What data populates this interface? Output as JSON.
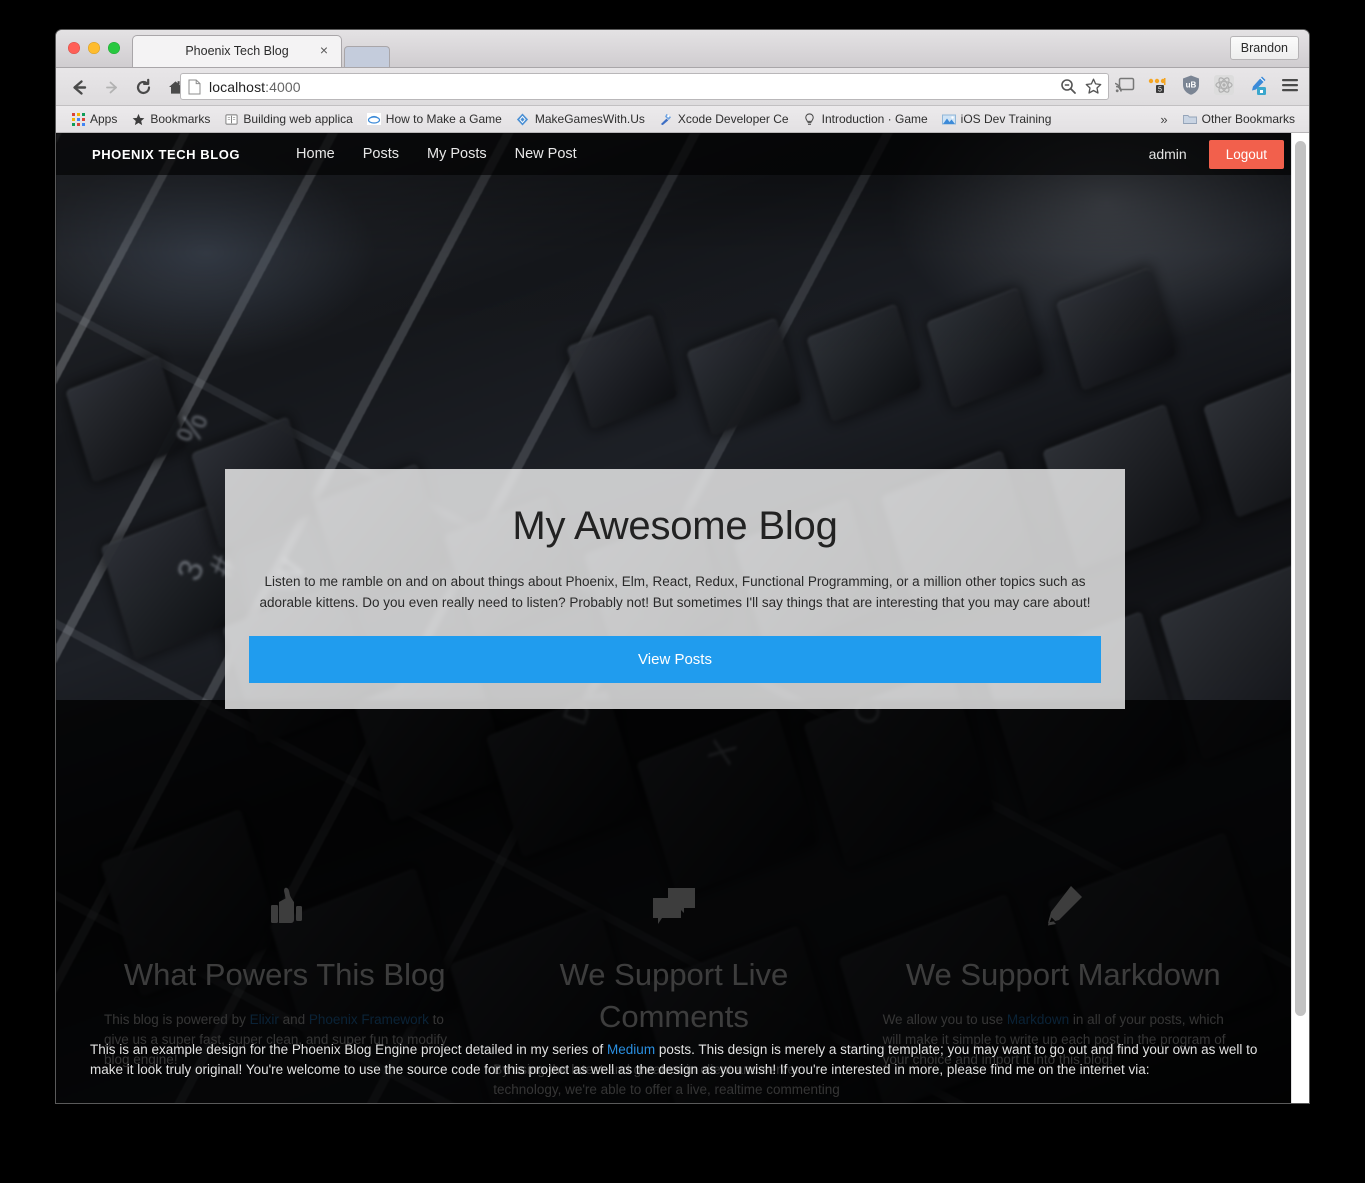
{
  "browser": {
    "profile_button": "Brandon",
    "tab_title": "Phoenix Tech Blog",
    "tab_close_glyph": "×",
    "url_display": "localhost:4000",
    "url_host": "localhost",
    "url_port": ":4000",
    "nav_icons": {
      "back": "back-arrow-icon",
      "forward": "forward-arrow-icon",
      "reload": "reload-icon",
      "home": "home-icon",
      "zoom_out": "zoom-out-icon",
      "bookmark_star": "star-icon",
      "cast": "cast-icon",
      "extension_dots": "colored-dots-extension-icon",
      "shield": "ublock-shield-icon",
      "atom": "react-devtools-icon",
      "eyedropper": "color-picker-icon",
      "menu": "hamburger-menu-icon"
    },
    "bookmarks": [
      {
        "label": "Apps",
        "icon": "apps-grid-icon"
      },
      {
        "label": "Bookmarks",
        "icon": "star-icon"
      },
      {
        "label": "Building web applica",
        "icon": "book-icon"
      },
      {
        "label": "How to Make a Game",
        "icon": "cloud-icon"
      },
      {
        "label": "MakeGamesWith.Us",
        "icon": "blue-diamond-icon"
      },
      {
        "label": "Xcode Developer Ce",
        "icon": "xcode-hammer-icon"
      },
      {
        "label": "Introduction · Game",
        "icon": "lightbulb-icon"
      },
      {
        "label": "iOS Dev Training",
        "icon": "mountain-photo-icon"
      }
    ],
    "overflow_glyph": "»",
    "other_bookmarks": {
      "label": "Other Bookmarks",
      "icon": "folder-icon"
    }
  },
  "site": {
    "navbar": {
      "brand": "PHOENIX TECH BLOG",
      "links": [
        {
          "label": "Home"
        },
        {
          "label": "Posts"
        },
        {
          "label": "My Posts"
        },
        {
          "label": "New Post"
        }
      ],
      "username": "admin",
      "logout_label": "Logout",
      "logout_color": "#f2604c"
    },
    "hero": {
      "title": "My Awesome Blog",
      "subtitle": "Listen to me ramble on and on about things about Phoenix, Elm, React, Redux, Functional Programming, or a million other topics such as adorable kittens. Do you even really need to listen? Probably not! But sometimes I'll say things that are interesting that you may care about!",
      "cta_label": "View Posts",
      "cta_color": "#209cee"
    },
    "features": [
      {
        "icon": "thumbs-up-icon",
        "heading": "What Powers This Blog",
        "body_parts": [
          {
            "text": "This blog is powered by ",
            "link": false
          },
          {
            "text": "Elixir",
            "link": true
          },
          {
            "text": " and ",
            "link": false
          },
          {
            "text": "Phoenix Framework",
            "link": true
          },
          {
            "text": " to give us a super fast, super clean, and super fun to modify blog engine!",
            "link": false
          }
        ]
      },
      {
        "icon": "speech-bubbles-icon",
        "heading": "We Support Live Comments",
        "body_parts": [
          {
            "text": "By using the latest and greatest in client and server technology, we're able to offer a live, realtime commenting system with nearly no impact to performance!",
            "link": false
          }
        ]
      },
      {
        "icon": "pencil-icon",
        "heading": "We Support Markdown",
        "body_parts": [
          {
            "text": "We allow you to use ",
            "link": false
          },
          {
            "text": "Markdown",
            "link": true
          },
          {
            "text": " in all of your posts, which will make it simple to write up each post in the program of your choice and import it into this blog!",
            "link": false
          }
        ]
      }
    ],
    "footer": {
      "parts": [
        {
          "text": "This is an example design for the Phoenix Blog Engine project detailed in my series of ",
          "link": false
        },
        {
          "text": "Medium",
          "link": true
        },
        {
          "text": " posts. This design is merely a starting template; you may want to go out and find your own as well to make it look truly original! You're welcome to use the source code for this project as well as the design as you wish! If you're interested in more, please find me on the internet via:",
          "link": false
        }
      ]
    },
    "link_color": "#2a8fe0"
  }
}
